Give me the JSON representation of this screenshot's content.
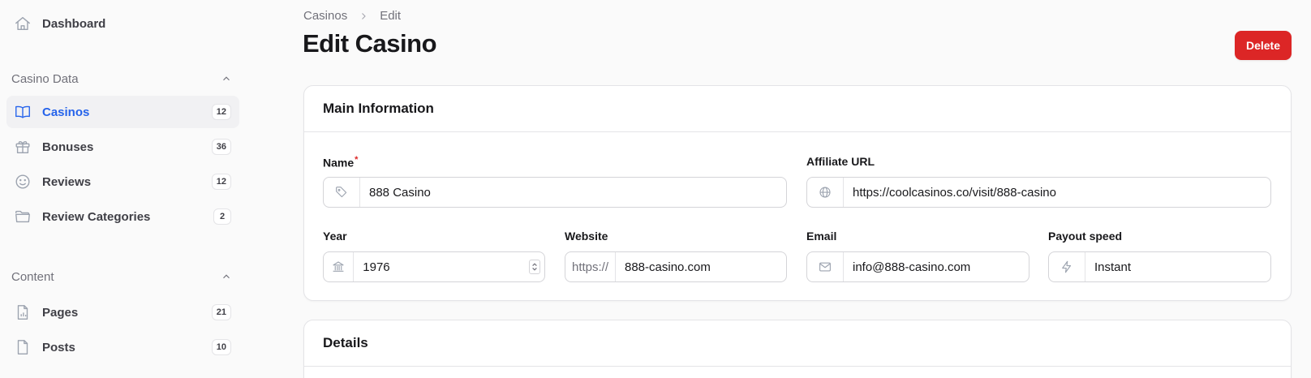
{
  "sidebar": {
    "dashboard": {
      "label": "Dashboard",
      "icon": "home-icon"
    },
    "groups": [
      {
        "label": "Casino Data",
        "items": [
          {
            "label": "Casinos",
            "count": "12",
            "icon": "book-open-icon",
            "active": true
          },
          {
            "label": "Bonuses",
            "count": "36",
            "icon": "gift-icon"
          },
          {
            "label": "Reviews",
            "count": "12",
            "icon": "face-smile-icon"
          },
          {
            "label": "Review Categories",
            "count": "2",
            "icon": "folder-open-icon"
          }
        ]
      },
      {
        "label": "Content",
        "items": [
          {
            "label": "Pages",
            "count": "21",
            "icon": "document-chart-icon"
          },
          {
            "label": "Posts",
            "count": "10",
            "icon": "document-icon"
          }
        ]
      }
    ]
  },
  "breadcrumb": [
    "Casinos",
    "Edit"
  ],
  "page": {
    "title": "Edit Casino",
    "delete_label": "Delete"
  },
  "colors": {
    "accent": "#2563eb",
    "danger": "#dc2626"
  },
  "main_info": {
    "heading": "Main Information",
    "name": {
      "label": "Name",
      "required": "*",
      "value": "888 Casino",
      "icon": "tag-icon"
    },
    "affiliate_url": {
      "label": "Affiliate URL",
      "value": "https://coolcasinos.co/visit/888-casino",
      "icon": "globe-icon"
    },
    "year": {
      "label": "Year",
      "value": "1976",
      "icon": "building-library-icon"
    },
    "website": {
      "label": "Website",
      "prefix": "https://",
      "value": "888-casino.com"
    },
    "email": {
      "label": "Email",
      "value": "info@888-casino.com",
      "icon": "envelope-icon"
    },
    "payout_speed": {
      "label": "Payout speed",
      "value": "Instant",
      "icon": "bolt-icon"
    }
  },
  "details": {
    "heading": "Details"
  }
}
